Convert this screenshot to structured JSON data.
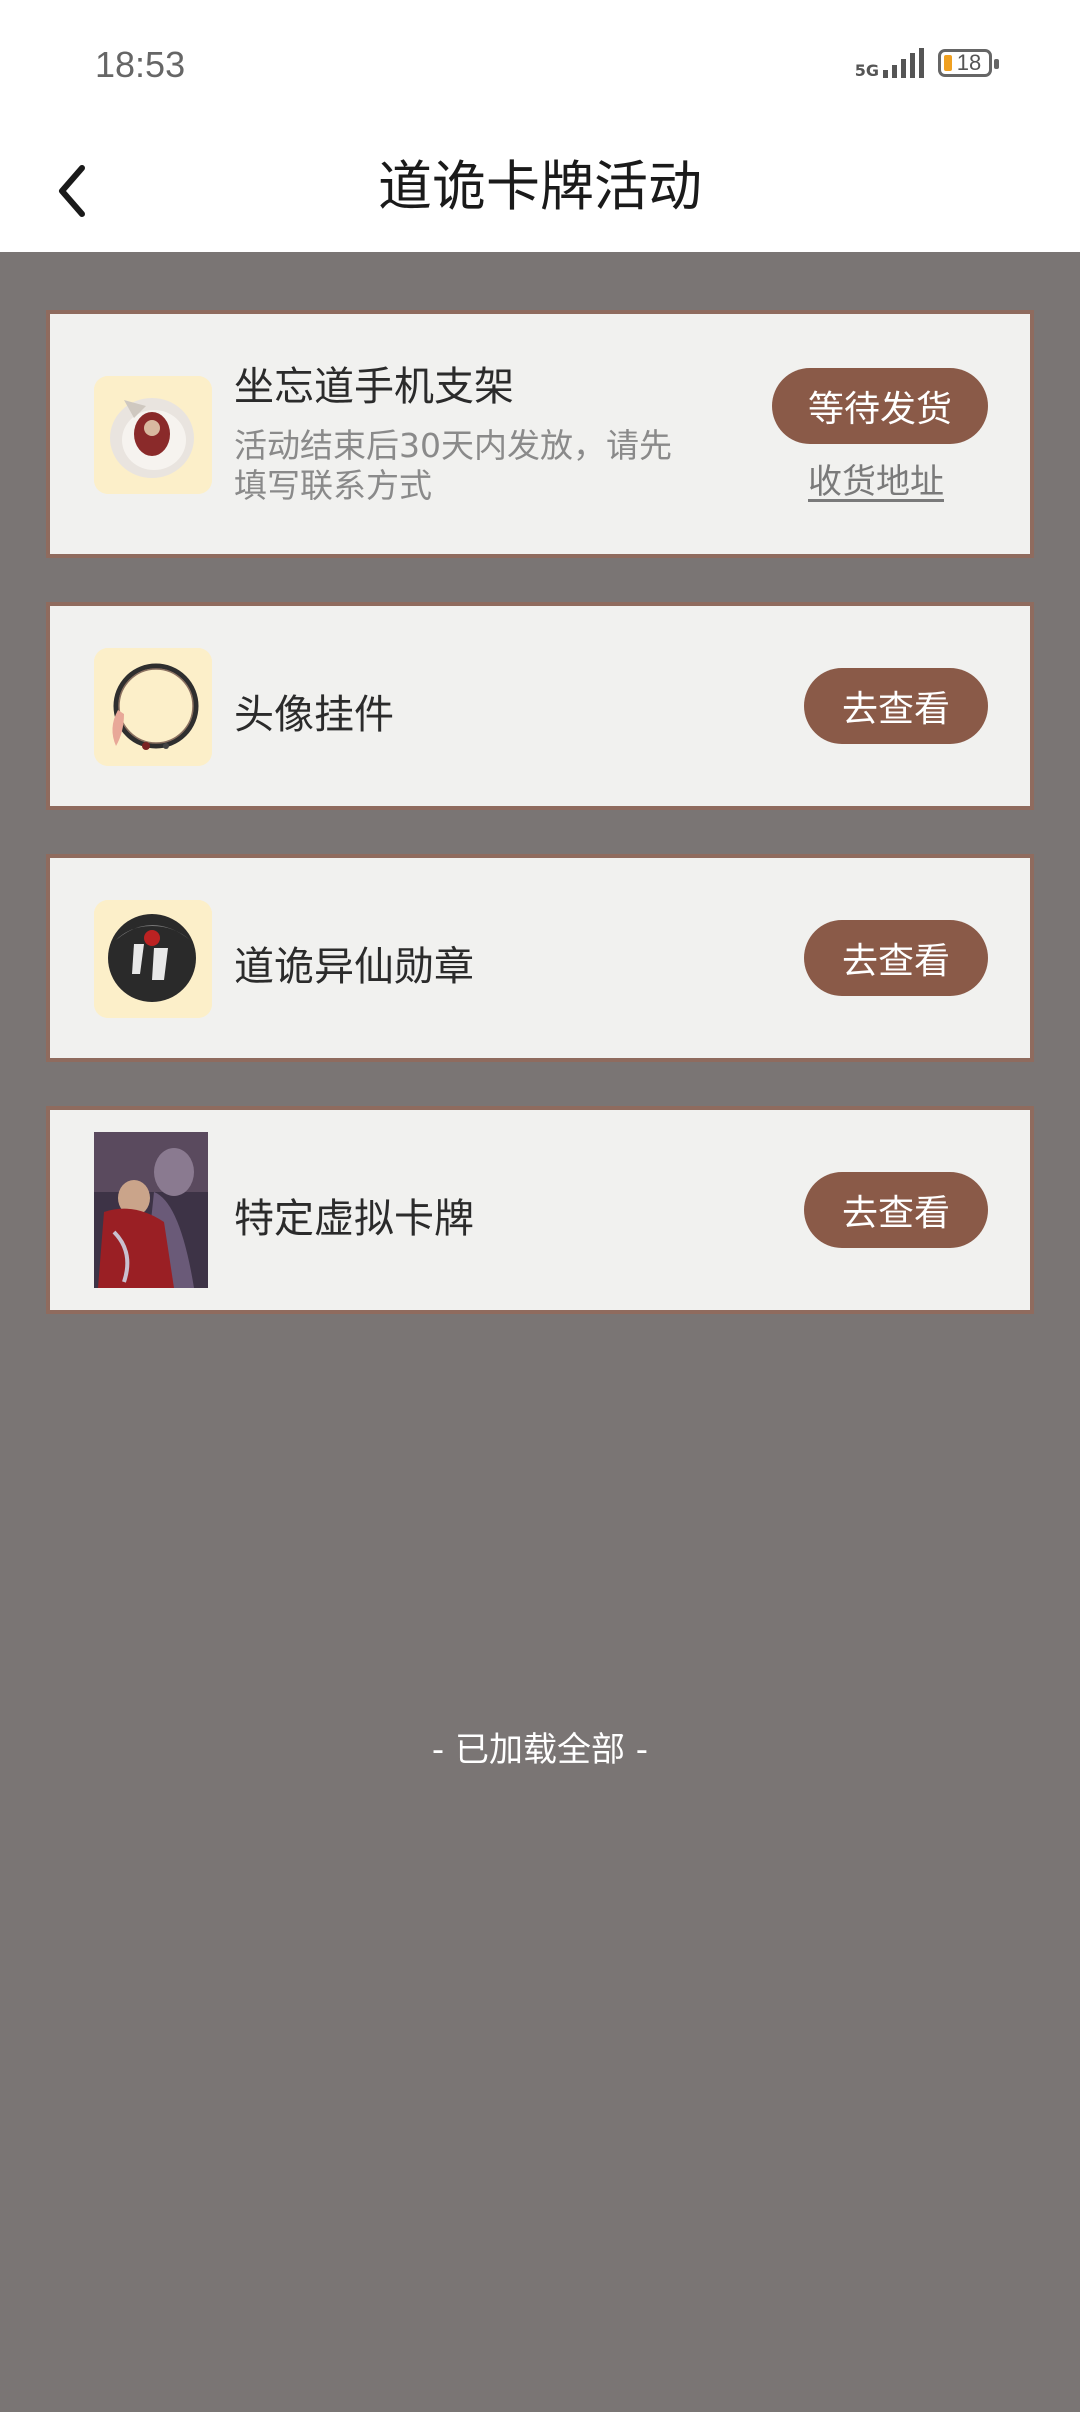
{
  "status_bar": {
    "time": "18:53",
    "network": "5G",
    "battery": "18"
  },
  "header": {
    "title": "道诡卡牌活动",
    "back_icon": "chevron-left-icon"
  },
  "items": [
    {
      "title": "坐忘道手机支架",
      "description": "活动结束后30天内发放，请先填写联系方式",
      "button": "等待发货",
      "link": "收货地址"
    },
    {
      "title": "头像挂件",
      "button": "去查看"
    },
    {
      "title": "道诡异仙勋章",
      "button": "去查看"
    },
    {
      "title": "特定虚拟卡牌",
      "button": "去查看"
    }
  ],
  "footer": {
    "text": "- 已加载全部 -"
  },
  "colors": {
    "background": "#7a7574",
    "card": "#f1f1ef",
    "card_border": "#8f6b5e",
    "button": "#8a5a48"
  }
}
